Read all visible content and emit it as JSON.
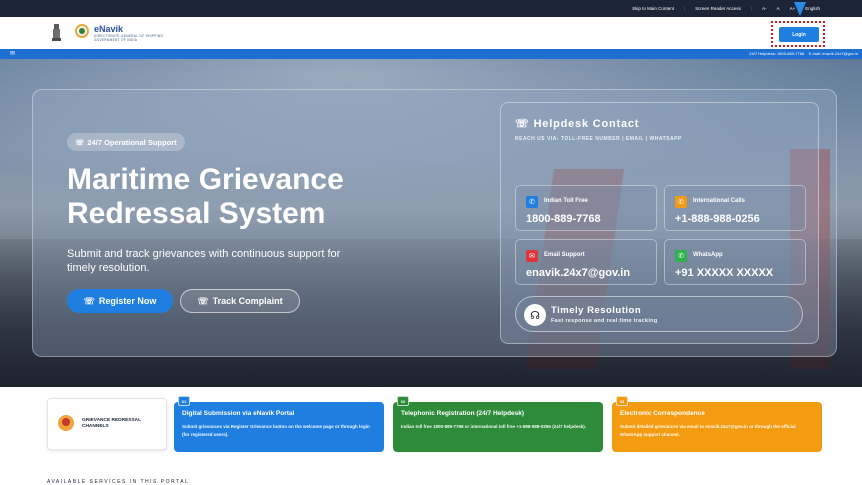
{
  "topbar": {
    "skip_link": "Skip to Main Content",
    "screen_reader": "Screen Reader Access",
    "font_small": "A-",
    "font_normal": "A",
    "font_large": "A+",
    "language": "English"
  },
  "header": {
    "brand_name": "eNavik",
    "brand_sub1": "DIRECTORATE GENERAL OF SHIPPING",
    "brand_sub2": "GOVERNMENT OF INDIA",
    "login_label": "Login"
  },
  "bluebar": {
    "helpdesk": "24/7 Helpdesk: 1800-889-7768",
    "email": "E-mail: enavik.24x7@gov.in"
  },
  "hero": {
    "badge": "24/7 Operational Support",
    "title_line1": "Maritime Grievance",
    "title_line2": "Redressal System",
    "subtitle": "Submit and track grievances with continuous support for timely resolution.",
    "register_label": "Register Now",
    "track_label": "Track Complaint"
  },
  "helpdesk": {
    "title": "Helpdesk Contact",
    "subtitle": "REACH US VIA: TOLL-FREE NUMBER | EMAIL | WHATSAPP",
    "cards": [
      {
        "label": "Indian Toll Free",
        "value": "1800-889-7768",
        "color": "#1f7fe0"
      },
      {
        "label": "International Calls",
        "value": "+1-888-988-0256",
        "color": "#f29a1a"
      },
      {
        "label": "Email Support",
        "value": "enavik.24x7@gov.in",
        "color": "#e0353b"
      },
      {
        "label": "WhatsApp",
        "value": "+91 XXXXX XXXXX",
        "color": "#2fb24c"
      }
    ],
    "timely_title": "Timely Resolution",
    "timely_sub": "Fast response and real time tracking"
  },
  "channels": {
    "line1": "GRIEVANCE REDRESSAL",
    "line2": "CHANNELS"
  },
  "steps": [
    {
      "num": "01",
      "title": "Digital Submission via eNavik Portal",
      "text": "Submit grievances via Register Grievance button on the welcome page or through login (for registered users).",
      "color": "#1f7fe0"
    },
    {
      "num": "02",
      "title": "Telephonic Registration (24/7 Helpdesk)",
      "text": "Indian toll free 1800-889-7768 or international toll free +1-888-988-0256 (24/7 helpdesk).",
      "color": "#2e8b3a"
    },
    {
      "num": "03",
      "title": "Electronic Correspondence",
      "text": "Submit detailed grievances via email to enavik.24x7@gov.in or through the official WhatsApp support channel.",
      "color": "#f39c12"
    }
  ],
  "available": "AVAILABLE SERVICES IN THIS PORTAL"
}
